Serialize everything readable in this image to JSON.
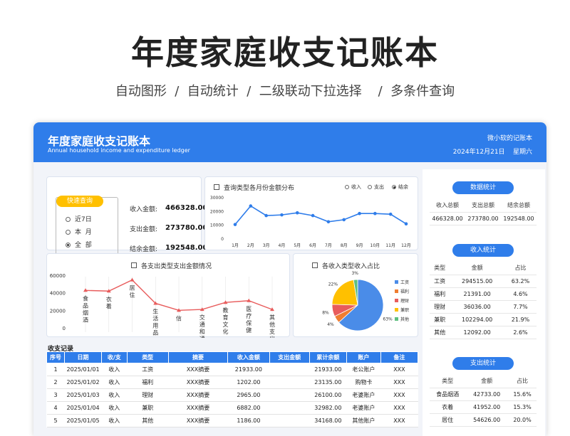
{
  "hero": {
    "title": "年度家庭收支记账本",
    "subtitle": "自动图形  /  自动统计  /  二级联动下拉选择    /  多条件查询"
  },
  "header": {
    "title": "年度家庭收支记账本",
    "subtitle_en": "Annual household income and expenditure ledger",
    "right_top": "微小软的记账本",
    "date": "2024年12月21日    星期六"
  },
  "query": {
    "tag": "快速查询",
    "options": [
      {
        "label": "近7日",
        "selected": false
      },
      {
        "label": "本  月",
        "selected": false
      },
      {
        "label": "全  部",
        "selected": true
      }
    ],
    "income_label": "收入金额:",
    "income": "466328.00",
    "expense_label": "支出金额:",
    "expense": "273780.00",
    "balance_label": "结余金额:",
    "balance": "192548.00"
  },
  "monthly": {
    "title": "查询类型各月份金额分布",
    "radios": [
      {
        "label": "收入",
        "selected": false
      },
      {
        "label": "支出",
        "selected": false
      },
      {
        "label": "结余",
        "selected": true
      }
    ]
  },
  "expense_chart": {
    "title": "各支出类型支出金额情况"
  },
  "income_pie": {
    "title": "各收入类型收入占比"
  },
  "chart_data": [
    {
      "type": "line",
      "title": "查询类型各月份金额分布",
      "categories": [
        "1月",
        "2月",
        "3月",
        "4月",
        "5月",
        "6月",
        "7月",
        "8月",
        "9月",
        "10月",
        "11月",
        "12月"
      ],
      "values": [
        10000,
        23500,
        16500,
        17000,
        18500,
        16500,
        12000,
        13500,
        18000,
        18000,
        17500,
        10500
      ],
      "yticks": [
        "0",
        "10000",
        "20000",
        "30000"
      ],
      "ylim": [
        0,
        30000
      ]
    },
    {
      "type": "line",
      "title": "各支出类型支出金额情况",
      "categories": [
        "食品烟酒",
        "衣着",
        "居住",
        "生活用品",
        "信",
        "交通和通",
        "教育文化",
        "医疗保健",
        "其他支出"
      ],
      "labels": [
        [
          "食",
          "品",
          "烟",
          "酒"
        ],
        [
          "衣",
          "着"
        ],
        [
          "居",
          "住"
        ],
        [
          "生",
          "活",
          "用",
          "品"
        ],
        [
          "信"
        ],
        [
          "交",
          "通",
          "和",
          "通"
        ],
        [
          "教",
          "育",
          "文",
          "化"
        ],
        [
          "医",
          "疗",
          "保",
          "健"
        ],
        [
          "其",
          "他",
          "支",
          "出"
        ]
      ],
      "values": [
        42733,
        41952,
        54626,
        28000,
        20000,
        21000,
        29000,
        31000,
        21000
      ],
      "yticks": [
        "0",
        "20000",
        "40000",
        "60000"
      ],
      "ylim": [
        0,
        60000
      ]
    },
    {
      "type": "pie",
      "title": "各收入类型收入占比",
      "slices": [
        {
          "label": "工资",
          "value": 63.2,
          "color": "#4a8ce8",
          "pct": "63%"
        },
        {
          "label": "福利",
          "value": 4.6,
          "color": "#ef7d31",
          "pct": "4%"
        },
        {
          "label": "理财",
          "value": 7.7,
          "color": "#e85c5c",
          "pct": "8%"
        },
        {
          "label": "兼职",
          "value": 21.9,
          "color": "#ffc000",
          "pct": "22%"
        },
        {
          "label": "其他",
          "value": 2.6,
          "color": "#5fbf80",
          "pct": "3%"
        }
      ]
    }
  ],
  "stats": {
    "title": "数据统计",
    "headers": [
      "收入总额",
      "支出总额",
      "结余总额"
    ],
    "values": [
      "466328.00",
      "273780.00",
      "192548.00"
    ]
  },
  "income_stats": {
    "title": "收入统计",
    "headers": [
      "类型",
      "金额",
      "占比"
    ],
    "rows": [
      [
        "工资",
        "294515.00",
        "63.2%"
      ],
      [
        "福利",
        "21391.00",
        "4.6%"
      ],
      [
        "理财",
        "36036.00",
        "7.7%"
      ],
      [
        "兼职",
        "102294.00",
        "21.9%"
      ],
      [
        "其他",
        "12092.00",
        "2.6%"
      ]
    ]
  },
  "expense_stats": {
    "title": "支出统计",
    "headers": [
      "类型",
      "金额",
      "占比"
    ],
    "rows": [
      [
        "食品烟酒",
        "42733.00",
        "15.6%"
      ],
      [
        "衣着",
        "41952.00",
        "15.3%"
      ],
      [
        "居住",
        "54626.00",
        "20.0%"
      ]
    ]
  },
  "ledger": {
    "title": "收支记录",
    "headers": [
      "序号",
      "日期",
      "收/支",
      "类型",
      "摘要",
      "收入金额",
      "支出金额",
      "累计余额",
      "账户",
      "备注"
    ],
    "rows": [
      [
        "1",
        "2025/01/01",
        "收入",
        "工资",
        "XXX摘要",
        "21933.00",
        "",
        "21933.00",
        "老公账户",
        "XXX"
      ],
      [
        "2",
        "2025/01/02",
        "收入",
        "福利",
        "XXX摘要",
        "1202.00",
        "",
        "23135.00",
        "购物卡",
        "XXX"
      ],
      [
        "3",
        "2025/01/03",
        "收入",
        "理财",
        "XXX摘要",
        "2965.00",
        "",
        "26100.00",
        "老婆账户",
        "XXX"
      ],
      [
        "4",
        "2025/01/04",
        "收入",
        "兼职",
        "XXX摘要",
        "6882.00",
        "",
        "32982.00",
        "老婆账户",
        "XXX"
      ],
      [
        "5",
        "2025/01/05",
        "收入",
        "其他",
        "XXX摘要",
        "1186.00",
        "",
        "34168.00",
        "其他账户",
        "XXX"
      ]
    ]
  }
}
